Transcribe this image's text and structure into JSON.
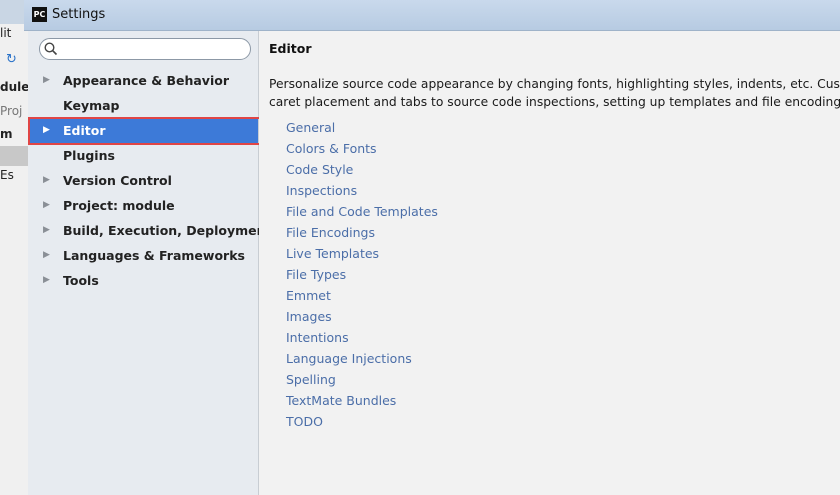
{
  "window": {
    "title": "Settings",
    "app_icon_text": "PC"
  },
  "background_ide": {
    "fragments": [
      "lit",
      "dule",
      "Proj",
      "m",
      "Es"
    ]
  },
  "search": {
    "value": "",
    "placeholder": ""
  },
  "tree": {
    "items": [
      {
        "label": "Appearance & Behavior",
        "expandable": true,
        "selected": false
      },
      {
        "label": "Keymap",
        "expandable": false,
        "selected": false
      },
      {
        "label": "Editor",
        "expandable": true,
        "selected": true
      },
      {
        "label": "Plugins",
        "expandable": false,
        "selected": false
      },
      {
        "label": "Version Control",
        "expandable": true,
        "selected": false
      },
      {
        "label": "Project: module",
        "expandable": true,
        "selected": false
      },
      {
        "label": "Build, Execution, Deployment",
        "expandable": true,
        "selected": false
      },
      {
        "label": "Languages & Frameworks",
        "expandable": true,
        "selected": false
      },
      {
        "label": "Tools",
        "expandable": true,
        "selected": false
      }
    ]
  },
  "content": {
    "heading": "Editor",
    "description_line1": "Personalize source code appearance by changing fonts, highlighting styles, indents, etc. Customize",
    "description_line2": "caret placement and tabs to source code inspections, setting up templates and file encodings.",
    "links": [
      "General",
      "Colors & Fonts",
      "Code Style",
      "Inspections",
      "File and Code Templates",
      "File Encodings",
      "Live Templates",
      "File Types",
      "Emmet",
      "Images",
      "Intentions",
      "Language Injections",
      "Spelling",
      "TextMate Bundles",
      "TODO"
    ]
  },
  "colors": {
    "selection": "#3d7ad8",
    "link": "#4b6ea8",
    "annotation_box": "#e04545"
  }
}
